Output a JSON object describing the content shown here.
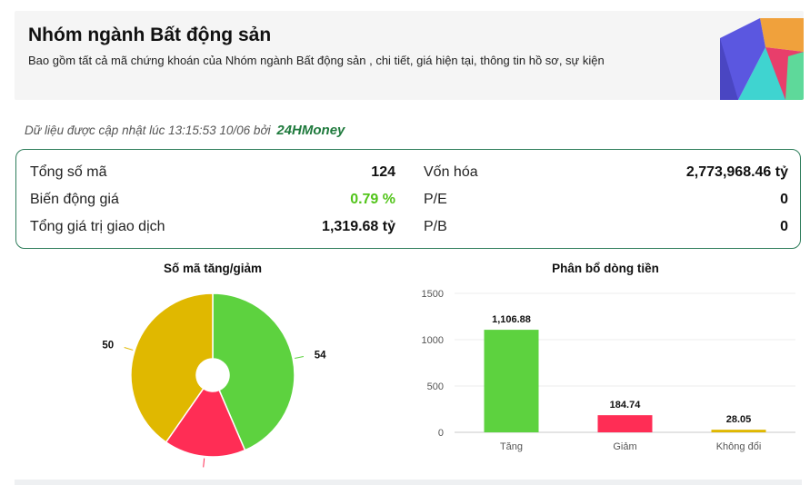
{
  "header": {
    "title": "Nhóm ngành Bất động sản",
    "description": "Bao gồm tất cả mã chứng khoán của Nhóm ngành Bất động sản , chi tiết, giá hiện tại, thông tin hồ sơ, sự kiện"
  },
  "updated": {
    "prefix": "Dữ liệu được cập nhật lúc 13:15:53 10/06 bởi",
    "brand": "24HMoney"
  },
  "stats": {
    "total_codes_label": "Tổng số mã",
    "total_codes_value": "124",
    "price_change_label": "Biến động giá",
    "price_change_value": "0.79 %",
    "trade_value_label": "Tổng giá trị giao dịch",
    "trade_value_value": "1,319.68 tỷ",
    "market_cap_label": "Vốn hóa",
    "market_cap_value": "2,773,968.46 tỷ",
    "pe_label": "P/E",
    "pe_value": "0",
    "pb_label": "P/B",
    "pb_value": "0"
  },
  "colors": {
    "up": "#5dd23f",
    "down": "#ff2d55",
    "unchanged": "#e0b800",
    "border": "#2e7d5b",
    "brand": "#1f7a3d"
  },
  "chart_data": [
    {
      "type": "pie",
      "title": "Số mã tăng/giảm",
      "categories": [
        "Tăng",
        "Giảm",
        "Không đổi"
      ],
      "values": [
        54,
        20,
        50
      ],
      "colors": [
        "#5dd23f",
        "#ff2d55",
        "#e0b800"
      ]
    },
    {
      "type": "bar",
      "title": "Phân bổ dòng tiền",
      "categories": [
        "Tăng",
        "Giảm",
        "Không đổi"
      ],
      "values": [
        1106.88,
        184.74,
        28.05
      ],
      "value_labels": [
        "1,106.88",
        "184.74",
        "28.05"
      ],
      "colors": [
        "#5dd23f",
        "#ff2d55",
        "#e0b800"
      ],
      "ylim": [
        0,
        1500
      ],
      "yticks": [
        0,
        500,
        1000,
        1500
      ],
      "grid": true
    }
  ]
}
